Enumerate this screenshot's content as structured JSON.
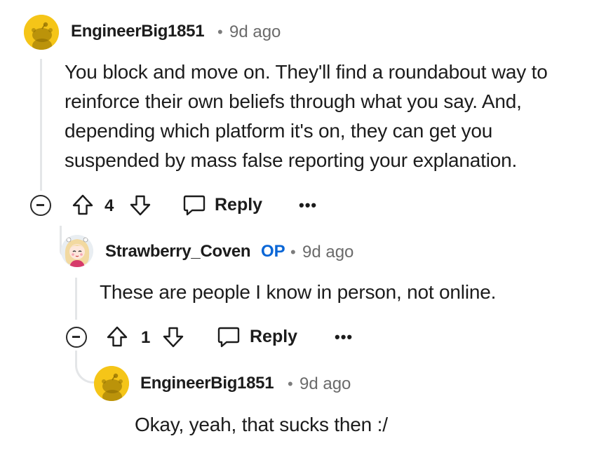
{
  "comments": [
    {
      "username": "EngineerBig1851",
      "separator": "•",
      "time": "9d ago",
      "avatar_icon": "snoo-avatar-yellow",
      "lines": [
        "You block and move on. They'll find a roundabout way to",
        "reinforce their own beliefs through what you say. And,",
        "depending which platform it's on, they can get you",
        "suspended by mass false reporting your explanation."
      ],
      "votes": "4",
      "reply_label": "Reply",
      "more_label": "•••"
    },
    {
      "username": "Strawberry_Coven",
      "op_badge": "OP",
      "separator": "•",
      "time": "9d ago",
      "avatar_icon": "anime-girl-avatar",
      "lines": [
        "These are people I know in person, not online."
      ],
      "votes": "1",
      "reply_label": "Reply",
      "more_label": "•••"
    },
    {
      "username": "EngineerBig1851",
      "separator": "•",
      "time": "9d ago",
      "avatar_icon": "snoo-avatar-yellow",
      "lines": [
        "Okay, yeah, that sucks then :/"
      ]
    }
  ],
  "colors": {
    "thread_line": "#e4e6e8",
    "op_blue": "#0a66d6",
    "avatar_yellow": "#f5c518"
  }
}
